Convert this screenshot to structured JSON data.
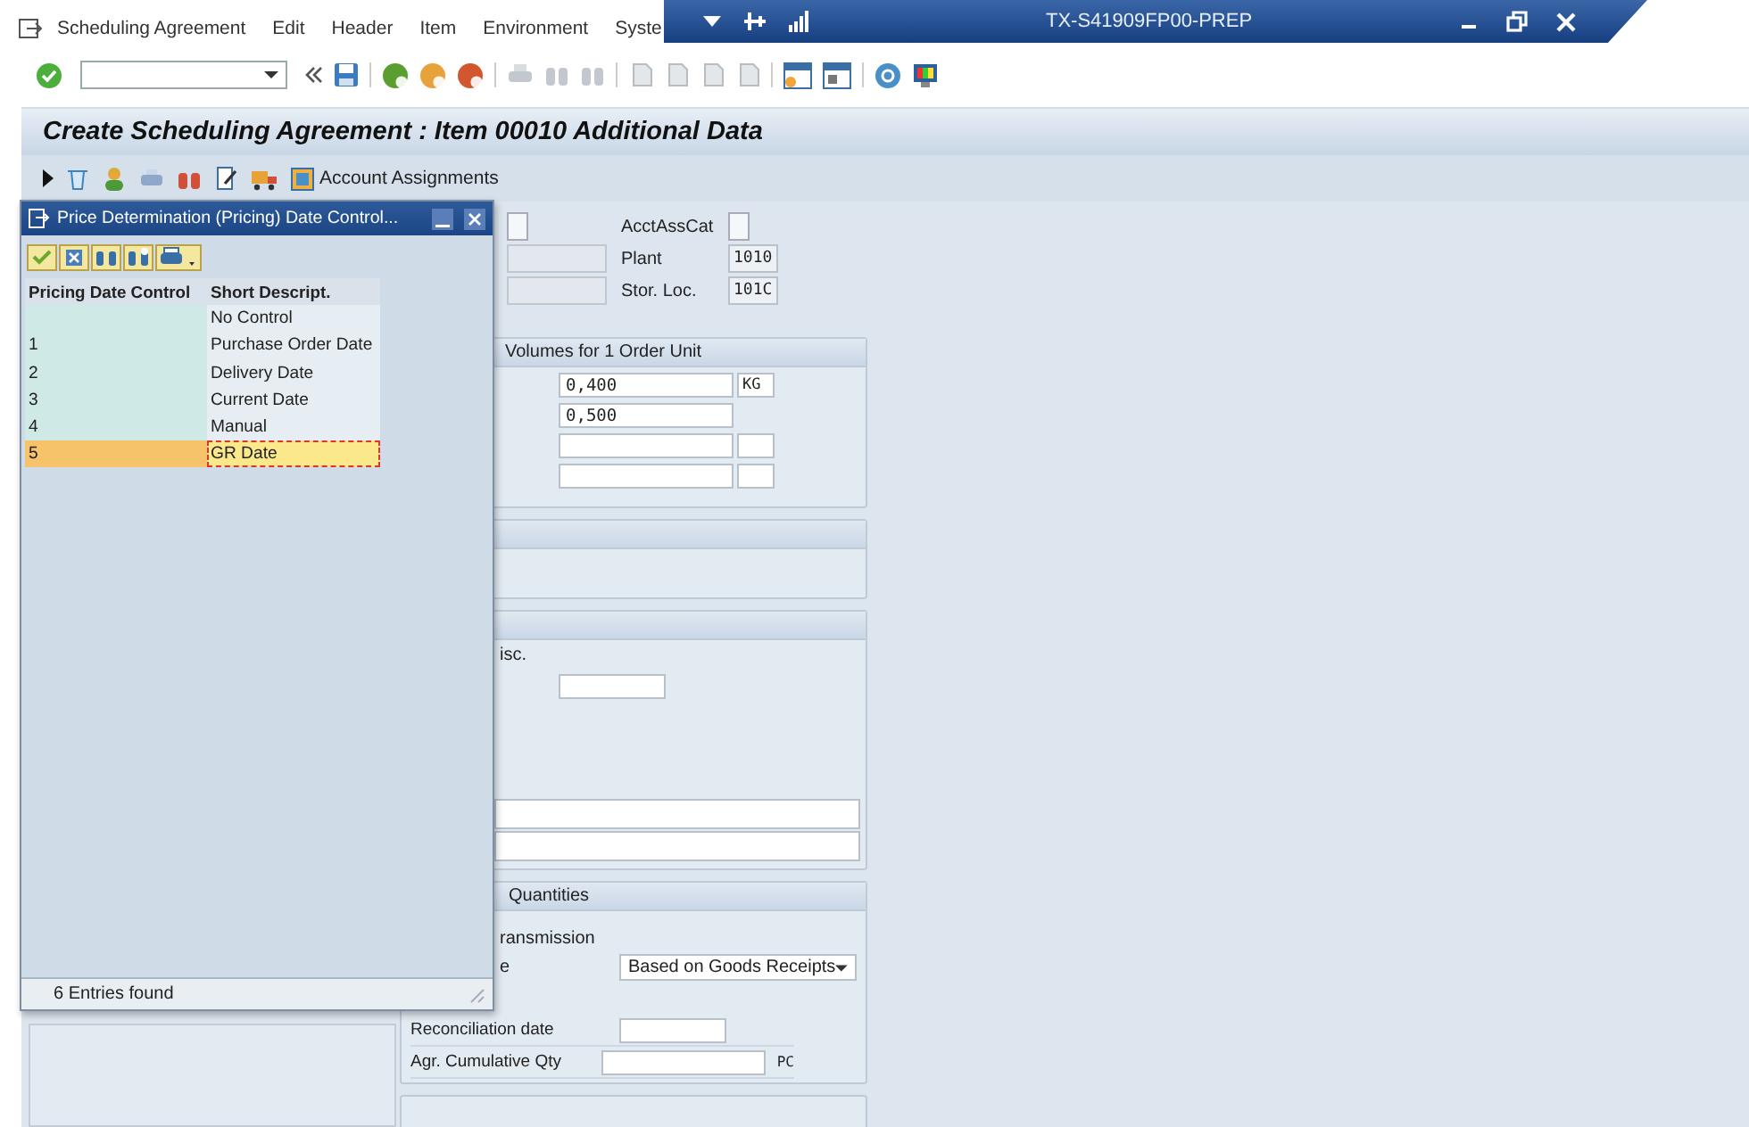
{
  "menu": [
    {
      "label": "Scheduling Agreement"
    },
    {
      "label": "Edit"
    },
    {
      "label": "Header"
    },
    {
      "label": "Item"
    },
    {
      "label": "Environment"
    },
    {
      "label": "Syste"
    }
  ],
  "window": {
    "title": "TX-S41909FP00-PREP"
  },
  "screen_title": "Create Scheduling Agreement : Item 00010 Additional Data",
  "app_toolbar": {
    "account_button": "Account Assignments"
  },
  "form": {
    "flag_checked": false,
    "acct_label": "AcctAssCat",
    "acct_checked": false,
    "plant_label": "Plant",
    "plant": "1010",
    "storloc_label": "Stor. Loc.",
    "storloc": "101C",
    "volumes": {
      "title": "Volumes for 1 Order Unit",
      "rows": [
        {
          "value": "0,400",
          "unit": "KG",
          "has_unit": true
        },
        {
          "value": "0,500",
          "has_unit": false
        },
        {
          "has_unit": true
        },
        {
          "has_unit": true
        }
      ]
    },
    "misc_fragment": "isc.",
    "quantities": {
      "title": "Quantities",
      "transmission_fragment": "ransmission",
      "type_fragment": "e",
      "type_value": "Based on Goods Receipts",
      "reconciliation_label": "Reconciliation date",
      "cumulative_label": "Agr. Cumulative Qty",
      "cumulative_unit": "PC"
    }
  },
  "dialog": {
    "title": "Price Determination (Pricing) Date Control...",
    "columns": [
      "Pricing Date Control",
      "Short Descript."
    ],
    "rows": [
      {
        "description": "No Control",
        "selected": false
      },
      {
        "code": "1",
        "description": "Purchase Order Date",
        "selected": false
      },
      {
        "code": "2",
        "description": "Delivery Date",
        "selected": false
      },
      {
        "code": "3",
        "description": "Current Date",
        "selected": false
      },
      {
        "code": "4",
        "description": "Manual",
        "selected": false
      },
      {
        "code": "5",
        "description": "GR Date",
        "selected": true
      }
    ],
    "status": "6 Entries found"
  }
}
